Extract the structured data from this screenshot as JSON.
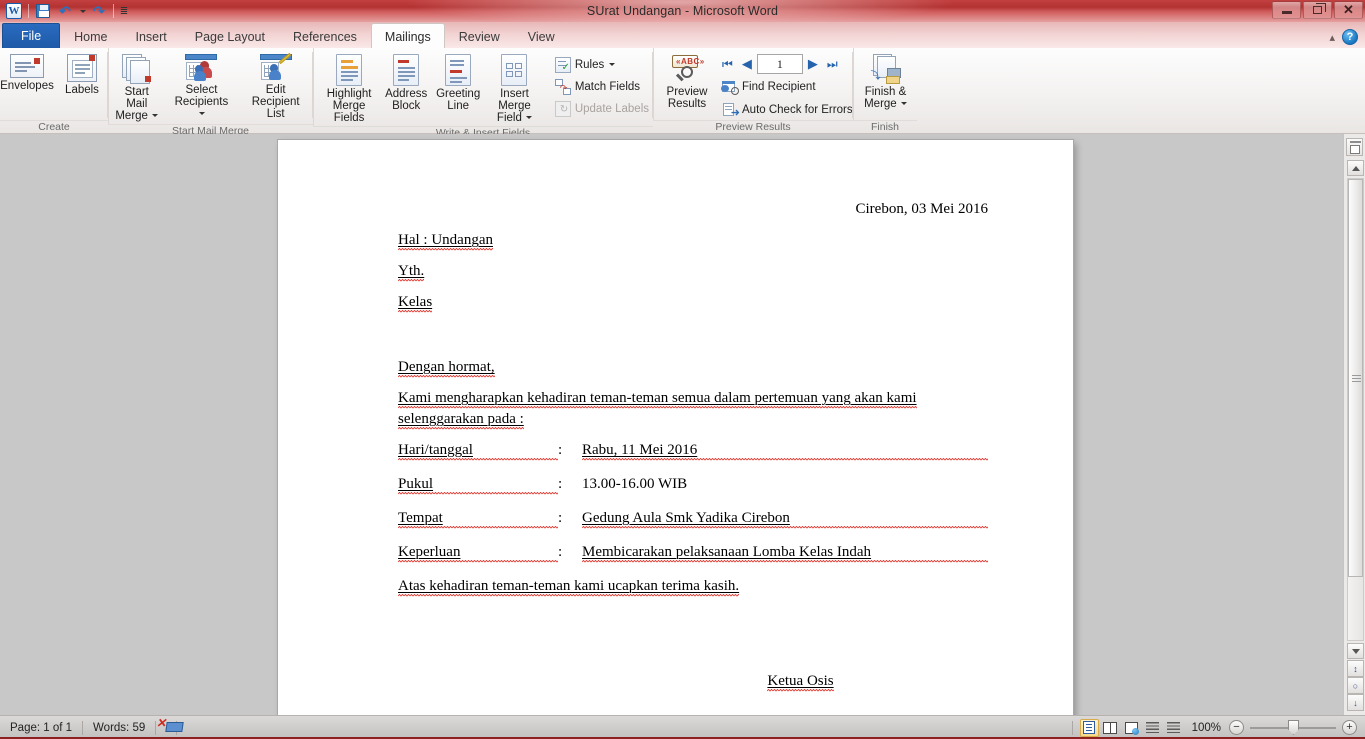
{
  "window": {
    "title": "SUrat Undangan  -  Microsoft Word",
    "minimize_label": "Minimize",
    "restore_label": "Restore",
    "close_label": "Close"
  },
  "quick_access": {
    "app_logo": "W",
    "items": [
      {
        "name": "save",
        "label": "Save"
      },
      {
        "name": "undo",
        "label": "Undo"
      },
      {
        "name": "redo",
        "label": "Redo"
      },
      {
        "name": "customize",
        "label": "Customize Quick Access Toolbar"
      }
    ]
  },
  "ribbon": {
    "tabs": [
      {
        "label": "File",
        "active": false,
        "kind": "file"
      },
      {
        "label": "Home",
        "active": false
      },
      {
        "label": "Insert",
        "active": false
      },
      {
        "label": "Page Layout",
        "active": false
      },
      {
        "label": "References",
        "active": false
      },
      {
        "label": "Mailings",
        "active": true
      },
      {
        "label": "Review",
        "active": false
      },
      {
        "label": "View",
        "active": false
      }
    ],
    "collapse_label": "Minimize the Ribbon",
    "help_label": "?",
    "groups": [
      {
        "title": "Create",
        "buttons": [
          {
            "label": "Envelopes",
            "icon": "envelope-icon"
          },
          {
            "label": "Labels",
            "icon": "labels-icon"
          }
        ]
      },
      {
        "title": "Start Mail Merge",
        "buttons": [
          {
            "label": "Start Mail\nMerge",
            "line1": "Start Mail",
            "line2": "Merge",
            "icon": "start-mail-merge-icon",
            "dropdown": true
          },
          {
            "label": "Select\nRecipients",
            "line1": "Select",
            "line2": "Recipients",
            "icon": "select-recipients-icon",
            "dropdown": true
          },
          {
            "label": "Edit\nRecipient List",
            "line1": "Edit",
            "line2": "Recipient List",
            "icon": "edit-recipient-list-icon",
            "dropdown": false
          }
        ]
      },
      {
        "title": "Write & Insert Fields",
        "buttons": [
          {
            "line1": "Highlight",
            "line2": "Merge Fields",
            "icon": "highlight-merge-fields-icon",
            "dropdown": false
          },
          {
            "line1": "Address",
            "line2": "Block",
            "icon": "address-block-icon",
            "dropdown": false
          },
          {
            "line1": "Greeting",
            "line2": "Line",
            "icon": "greeting-line-icon",
            "dropdown": false
          },
          {
            "line1": "Insert Merge",
            "line2": "Field",
            "icon": "insert-merge-field-icon",
            "dropdown": true
          }
        ],
        "small_buttons": [
          {
            "label": "Rules",
            "icon": "rules-icon",
            "dropdown": true,
            "disabled": false
          },
          {
            "label": "Match Fields",
            "icon": "match-fields-icon",
            "dropdown": false,
            "disabled": false
          },
          {
            "label": "Update Labels",
            "icon": "update-labels-icon",
            "dropdown": false,
            "disabled": true
          }
        ]
      },
      {
        "title": "Preview Results",
        "buttons": [
          {
            "line1": "Preview",
            "line2": "Results",
            "icon": "preview-results-icon",
            "dropdown": false
          }
        ],
        "record_nav": {
          "first": "first-record-icon",
          "prev": "previous-record-icon",
          "value": "1",
          "next": "next-record-icon",
          "last": "last-record-icon"
        },
        "small_buttons": [
          {
            "label": "Find Recipient",
            "icon": "find-recipient-icon",
            "disabled": false
          },
          {
            "label": "Auto Check for Errors",
            "icon": "auto-check-errors-icon",
            "disabled": false
          }
        ]
      },
      {
        "title": "Finish",
        "buttons": [
          {
            "line1": "Finish &",
            "line2": "Merge",
            "icon": "finish-merge-icon",
            "dropdown": true
          }
        ]
      }
    ]
  },
  "document": {
    "date_line": "Cirebon, 03 Mei 2016",
    "subject": "Hal : Undangan",
    "recipient_label": "Yth.",
    "recipient_class": "Kelas",
    "greeting": "Dengan hormat,",
    "body_line1": "Kami mengharapkan kehadiran teman-teman semua dalam pertemuan yang akan kami",
    "body_line2": "selenggarakan pada :",
    "details": [
      {
        "key": "Hari/tanggal",
        "colon": ":",
        "value": "Rabu, 11 Mei 2016"
      },
      {
        "key": "Pukul",
        "colon": ":",
        "value": "13.00-16.00 WIB"
      },
      {
        "key": "Tempat",
        "colon": ":",
        "value": "Gedung Aula Smk Yadika Cirebon"
      },
      {
        "key": "Keperluan",
        "colon": ":",
        "value": "Membicarakan pelaksanaan Lomba Kelas Indah"
      }
    ],
    "closing": "Atas kehadiran teman-teman kami ucapkan terima kasih.",
    "signature": "Ketua Osis"
  },
  "scroll_rail": {
    "ruler_toggle": "View Ruler",
    "scroll_up": "Scroll Up",
    "scroll_down": "Scroll Down",
    "previous_page": "Previous Page",
    "select_browse_object": "Select Browse Object",
    "next_page": "Next Page"
  },
  "status_bar": {
    "page": "Page: 1 of 1",
    "words": "Words: 59",
    "proofing_icon": "spelling-errors-icon",
    "views": [
      {
        "name": "print-layout-view",
        "selected": true
      },
      {
        "name": "full-screen-reading-view",
        "selected": false
      },
      {
        "name": "web-layout-view",
        "selected": false
      },
      {
        "name": "outline-view",
        "selected": false
      },
      {
        "name": "draft-view",
        "selected": false
      }
    ],
    "zoom_level": "100%",
    "zoom_out": "−",
    "zoom_in": "+"
  },
  "colors": {
    "title_red": "#b33232",
    "file_tab_blue": "#1e5aa8",
    "spell_red": "#e03a30",
    "grammar_green": "#1e9e3a",
    "page_white": "#ffffff",
    "canvas_gray": "#c8c8c8"
  }
}
